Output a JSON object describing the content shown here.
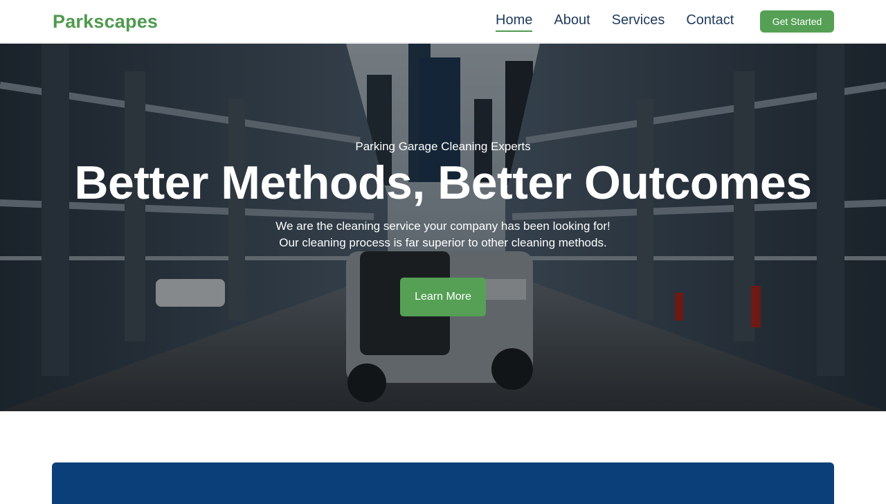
{
  "brand": {
    "name": "Parkscapes",
    "accent": "#55a055",
    "navy": "#0b3f7a"
  },
  "nav": {
    "items": [
      {
        "label": "Home",
        "active": true
      },
      {
        "label": "About",
        "active": false
      },
      {
        "label": "Services",
        "active": false
      },
      {
        "label": "Contact",
        "active": false
      }
    ],
    "cta_label": "Get Started"
  },
  "hero": {
    "eyebrow": "Parking Garage Cleaning Experts",
    "headline": "Better Methods, Better Outcomes",
    "subtext_line1": "We are the cleaning service your company has been looking for!",
    "subtext_line2": "Our cleaning process is far superior to other cleaning methods.",
    "button_label": "Learn More",
    "image_description_icon": "parking-garage-floor-scrubber-image"
  }
}
